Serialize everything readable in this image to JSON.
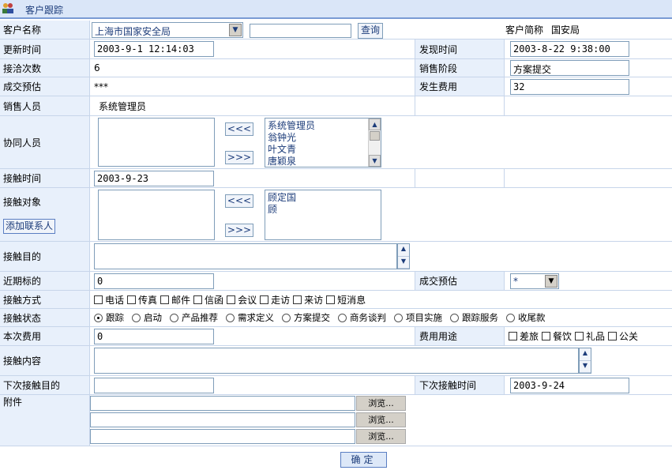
{
  "header": {
    "title": "客户跟踪"
  },
  "customer": {
    "label": "客户名称",
    "selected": "上海市国家安全局",
    "search_value": "",
    "search_button": "查询",
    "short_label": "客户简称",
    "short_value": "国安局"
  },
  "update": {
    "label": "更新时间",
    "value": "2003-9-1 12:14:03",
    "found_label": "发现时间",
    "found_value": "2003-8-22 9:38:00"
  },
  "contact_count": {
    "label": "接洽次数",
    "value": "6",
    "stage_label": "销售阶段",
    "stage_value": "方案提交"
  },
  "forecast": {
    "label": "成交预估",
    "value": "***",
    "cost_label": "发生费用",
    "cost_value": "32"
  },
  "sales": {
    "label": "销售人员",
    "value": "系统管理员"
  },
  "coworkers": {
    "label": "协同人员",
    "btn_left": "<<<",
    "btn_right": ">>>",
    "available": [
      "系统管理员",
      "翁钟光",
      "叶文青",
      "唐颖泉"
    ]
  },
  "contact_time": {
    "label": "接触时间",
    "value": "2003-9-23"
  },
  "contact_target": {
    "label": "接触对象",
    "btn_left": "<<<",
    "btn_right": ">>>",
    "available": [
      "顾定国",
      "顾"
    ],
    "add_button": "添加联系人"
  },
  "purpose": {
    "label": "接触目的",
    "value": ""
  },
  "near_target": {
    "label": "近期标的",
    "value": "0",
    "forecast_label": "成交预估",
    "forecast_value": "*"
  },
  "method": {
    "label": "接触方式",
    "options": [
      "电话",
      "传真",
      "邮件",
      "信函",
      "会议",
      "走访",
      "来访",
      "短消息"
    ]
  },
  "status": {
    "label": "接触状态",
    "options": [
      "跟踪",
      "启动",
      "产品推荐",
      "需求定义",
      "方案提交",
      "商务谈判",
      "项目实施",
      "跟踪服务",
      "收尾款"
    ],
    "selected_index": 0
  },
  "this_cost": {
    "label": "本次费用",
    "value": "0",
    "usage_label": "费用用途",
    "usage_options": [
      "差旅",
      "餐饮",
      "礼品",
      "公关"
    ]
  },
  "content": {
    "label": "接触内容",
    "value": ""
  },
  "next": {
    "label": "下次接触目的",
    "value": "",
    "time_label": "下次接触时间",
    "time_value": "2003-9-24"
  },
  "attachment": {
    "label": "附件",
    "browse": "浏览..."
  },
  "submit": {
    "label": "确定"
  }
}
